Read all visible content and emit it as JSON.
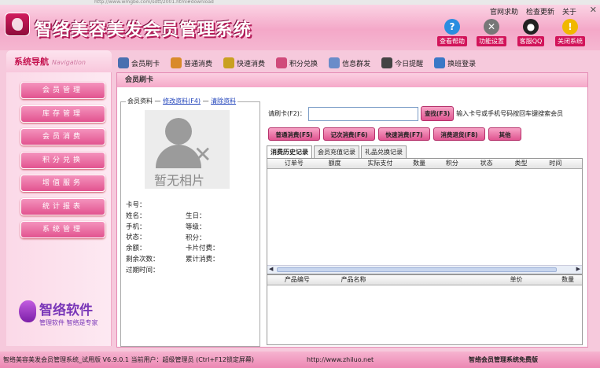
{
  "url_bar": "http://www.wmgbe.com/sdtt/2001.html#download",
  "app_title": "智络美容美发会员管理系统",
  "top_links": [
    "官网求助",
    "检查更新",
    "关于"
  ],
  "window_controls": "✕",
  "quick_buttons": [
    {
      "label": "查看帮助",
      "icon": "help-icon",
      "color": "#2a8de0",
      "glyph": "?"
    },
    {
      "label": "功能设置",
      "icon": "tools-icon",
      "color": "#777777",
      "glyph": "✕"
    },
    {
      "label": "客服QQ",
      "icon": "qq-icon",
      "color": "#222222",
      "glyph": "●"
    },
    {
      "label": "关闭系统",
      "icon": "warning-icon",
      "color": "#f0b800",
      "glyph": "!"
    }
  ],
  "nav_header": {
    "title": "系统导航",
    "subtitle": "Navigation"
  },
  "toolbar": [
    {
      "label": "会员刷卡",
      "icon": "card-icon",
      "color": "#4a6fb0"
    },
    {
      "label": "普通消费",
      "icon": "person-icon",
      "color": "#d98a2a"
    },
    {
      "label": "快速消费",
      "icon": "cart-icon",
      "color": "#c9a020"
    },
    {
      "label": "积分兑换",
      "icon": "gift-icon",
      "color": "#d04a7a"
    },
    {
      "label": "信息群发",
      "icon": "message-icon",
      "color": "#6a8cc9"
    },
    {
      "label": "今日提醒",
      "icon": "clock-icon",
      "color": "#444444"
    },
    {
      "label": "换班登录",
      "icon": "login-icon",
      "color": "#3a78c6"
    }
  ],
  "sidebar": [
    "会员管理",
    "库存管理",
    "会员消费",
    "积分兑换",
    "增值服务",
    "统计报表",
    "系统管理"
  ],
  "brand": {
    "name": "智络软件",
    "slogan": "管理软件 智络是专家"
  },
  "panel_title": "会员刷卡",
  "member_box": {
    "legend": "会员资料",
    "edit_link": "修改资料(F4)",
    "clear_link": "清除资料",
    "photo_text": "暂无相片",
    "fields_left": [
      "卡号：",
      "姓名：",
      "手机：",
      "状态：",
      "余额：",
      "剩余次数：",
      "过期时间："
    ],
    "fields_right": [
      "生日：",
      "等级：",
      "积分：",
      "卡片付费：",
      "累计消费："
    ]
  },
  "card": {
    "label": "请刷卡(F2)：",
    "value": "",
    "search_btn": "查找(F3)",
    "hint": "输入卡号或手机号码按回车键搜索会员"
  },
  "action_buttons": [
    "普通消费(F5)",
    "记次消费(F6)",
    "快速消费(F7)",
    "消费退货(F8)",
    "其他"
  ],
  "tabs": [
    "消费历史记录",
    "会员充值记录",
    "礼品兑换记录"
  ],
  "history_columns": [
    "订单号",
    "额度",
    "实际支付",
    "数量",
    "积分",
    "状态",
    "类型",
    "时间"
  ],
  "product_columns": [
    "产品编号",
    "产品名称",
    "单价",
    "数量"
  ],
  "status_bar": {
    "left": "智络美容美发会员管理系统_试用版 V6.9.0.1 当前用户：超级管理员 (Ctrl+F12锁定屏幕)",
    "url": "http://www.zhiluo.net",
    "right": "智络会员管理系统免费版"
  }
}
